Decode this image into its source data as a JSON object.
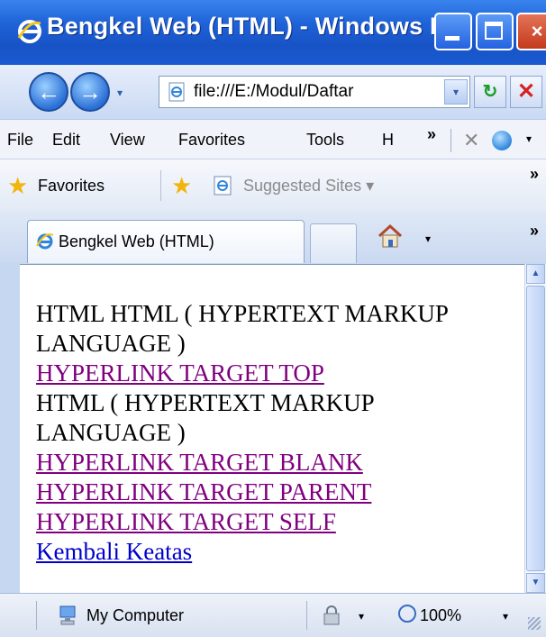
{
  "window": {
    "title": "Bengkel Web (HTML) - Windows I...",
    "icon": "ie-icon",
    "controls": {
      "minimize": "minimize-icon",
      "maximize": "maximize-icon",
      "close": "×"
    }
  },
  "address_bar": {
    "url": "file:///E:/Modul/Daftar",
    "nav_back": "←",
    "nav_forward": "→",
    "dropdown": "▾",
    "refresh": "↻",
    "stop": "✕"
  },
  "menu_bar": {
    "items": [
      "File",
      "Edit",
      "View",
      "Favorites",
      "Tools",
      "H"
    ],
    "overflow": "»"
  },
  "favorites_bar": {
    "favorites_label": "Favorites",
    "suggested_sites": "Suggested Sites ▾",
    "overflow": "»"
  },
  "tabs": {
    "active_label": "Bengkel Web (HTML)",
    "home_drop": "▾",
    "overflow": "»"
  },
  "content": {
    "lines": [
      {
        "type": "text",
        "text": "HTML HTML ( HYPERTEXT MARKUP LANGUAGE )"
      },
      {
        "type": "link",
        "text": "HYPERLINK TARGET TOP"
      },
      {
        "type": "text",
        "text": "HTML ( HYPERTEXT MARKUP LANGUAGE )"
      },
      {
        "type": "link",
        "text": "HYPERLINK TARGET BLANK"
      },
      {
        "type": "link",
        "text": "HYPERLINK TARGET PARENT"
      },
      {
        "type": "link",
        "text": "HYPERLINK TARGET SELF"
      },
      {
        "type": "link_unvisited",
        "text": "Kembali Keatas"
      }
    ]
  },
  "status_bar": {
    "zone": "My Computer",
    "zoom": "100%",
    "drop": "▾"
  },
  "colors": {
    "titlebar": "#1f63d8",
    "visited_link": "#800080",
    "unvisited_link": "#0000cc"
  }
}
